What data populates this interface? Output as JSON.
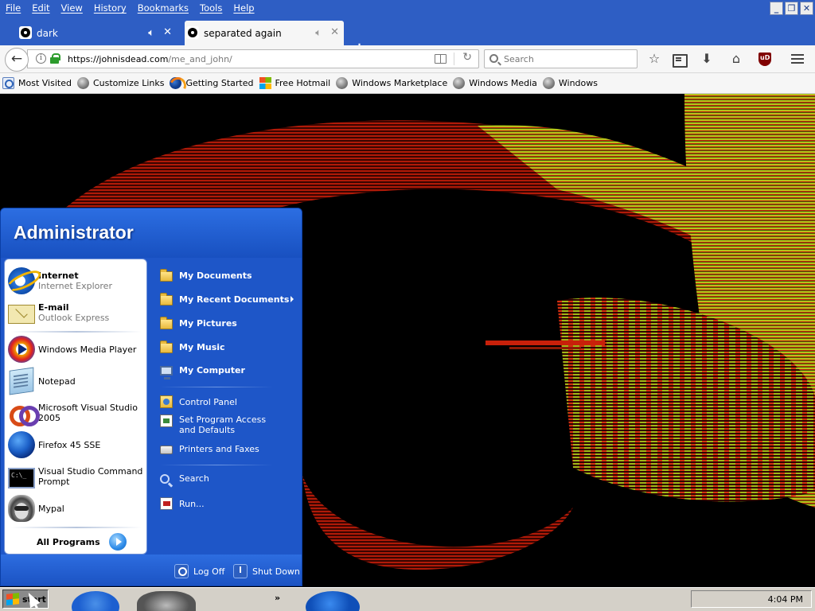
{
  "menubar": {
    "items": [
      "File",
      "Edit",
      "View",
      "History",
      "Bookmarks",
      "Tools",
      "Help"
    ],
    "window_buttons": [
      "minimize-icon",
      "restore-icon",
      "close-icon"
    ]
  },
  "tabs": [
    {
      "title": "dark",
      "active": false
    },
    {
      "title": "separated again",
      "active": true
    }
  ],
  "address": {
    "scheme_host": "https://johnisdead.com",
    "path": "/me_and_john/"
  },
  "search": {
    "placeholder": "Search"
  },
  "bookmarks": [
    {
      "label": "Most Visited",
      "icon": "most-visited-icon"
    },
    {
      "label": "Customize Links",
      "icon": "globe-icon"
    },
    {
      "label": "Getting Started",
      "icon": "firefox-icon"
    },
    {
      "label": "Free Hotmail",
      "icon": "windows-logo-icon"
    },
    {
      "label": "Windows Marketplace",
      "icon": "globe-icon"
    },
    {
      "label": "Windows Media",
      "icon": "globe-icon"
    },
    {
      "label": "Windows",
      "icon": "globe-icon"
    }
  ],
  "start_menu": {
    "user": "Administrator",
    "pinned": [
      {
        "title": "Internet",
        "subtitle": "Internet Explorer",
        "icon": "internet-explorer-icon"
      },
      {
        "title": "E-mail",
        "subtitle": "Outlook Express",
        "icon": "outlook-express-icon"
      }
    ],
    "recent": [
      {
        "label": "Windows Media Player",
        "icon": "windows-media-player-icon"
      },
      {
        "label": "Notepad",
        "icon": "notepad-icon"
      },
      {
        "label": "Microsoft Visual Studio 2005",
        "icon": "visual-studio-icon"
      },
      {
        "label": "Firefox 45 SSE",
        "icon": "firefox-icon"
      },
      {
        "label": "Visual Studio Command Prompt",
        "icon": "command-prompt-icon"
      },
      {
        "label": "Mypal",
        "icon": "mypal-icon"
      }
    ],
    "all_programs": "All Programs",
    "places": [
      {
        "label": "My Documents",
        "bold": true,
        "icon": "folder-icon"
      },
      {
        "label": "My Recent Documents",
        "bold": true,
        "icon": "folder-icon",
        "submenu": true
      },
      {
        "label": "My Pictures",
        "bold": true,
        "icon": "folder-icon"
      },
      {
        "label": "My Music",
        "bold": true,
        "icon": "folder-icon"
      },
      {
        "label": "My Computer",
        "bold": true,
        "icon": "computer-icon"
      }
    ],
    "settings": [
      {
        "label": "Control Panel",
        "icon": "control-panel-icon"
      },
      {
        "label": "Set Program Access and Defaults",
        "icon": "program-access-icon"
      },
      {
        "label": "Printers and Faxes",
        "icon": "printer-icon"
      }
    ],
    "tools": [
      {
        "label": "Search",
        "icon": "search-icon"
      },
      {
        "label": "Run...",
        "icon": "run-icon"
      }
    ],
    "footer": {
      "log_off": "Log Off",
      "shut_down": "Shut Down"
    }
  },
  "taskbar": {
    "start_label": "start",
    "clock": "4:04 PM"
  },
  "colors": {
    "titlebar": "#2e5ec4",
    "start_menu_blue": "#1e56c8",
    "taskbar": "#d4d0c8"
  }
}
